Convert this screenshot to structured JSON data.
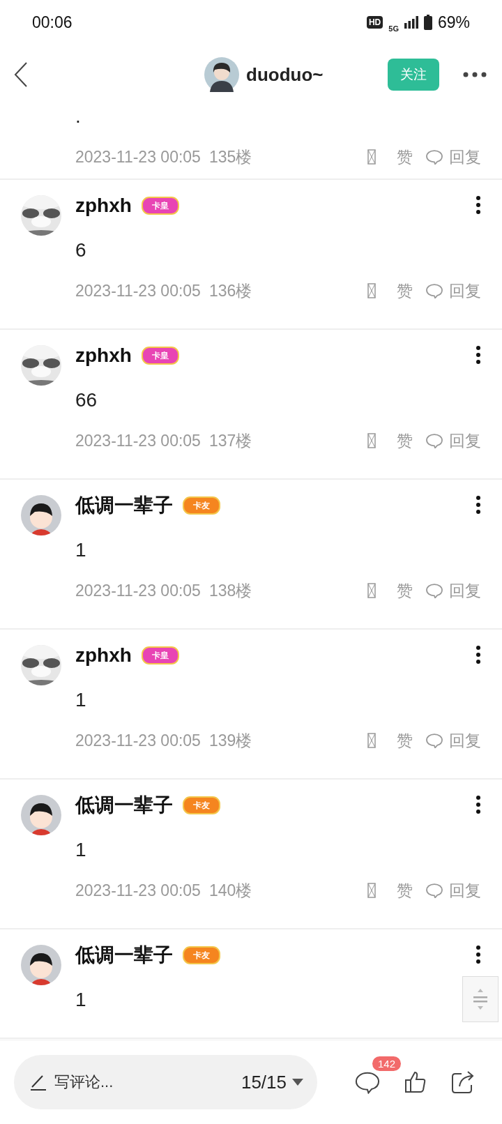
{
  "status_bar": {
    "time": "00:06",
    "hd": "HD",
    "network": "5G",
    "battery": "69%"
  },
  "header": {
    "user": "duoduo~",
    "follow": "关注"
  },
  "posts": [
    {
      "content": ".",
      "date": "2023-11-23 00:05",
      "floor": "135楼",
      "like": "赞",
      "reply": "回复"
    },
    {
      "author": "zphxh",
      "badge": {
        "label": "卡皇",
        "color": "#e844b4"
      },
      "content": "6",
      "date": "2023-11-23 00:05",
      "floor": "136楼",
      "like": "赞",
      "reply": "回复"
    },
    {
      "author": "zphxh",
      "badge": {
        "label": "卡皇",
        "color": "#e844b4"
      },
      "content": "66",
      "date": "2023-11-23 00:05",
      "floor": "137楼",
      "like": "赞",
      "reply": "回复"
    },
    {
      "author": "低调一辈子",
      "avatar": {
        "kind": "cartoon"
      },
      "badge": {
        "label": "卡友",
        "color": "#f5851f"
      },
      "content": "1",
      "date": "2023-11-23 00:05",
      "floor": "138楼",
      "like": "赞",
      "reply": "回复"
    },
    {
      "author": "zphxh",
      "badge": {
        "label": "卡皇",
        "color": "#e844b4"
      },
      "content": "1",
      "date": "2023-11-23 00:05",
      "floor": "139楼",
      "like": "赞",
      "reply": "回复"
    },
    {
      "author": "低调一辈子",
      "avatar": {
        "kind": "cartoon"
      },
      "badge": {
        "label": "卡友",
        "color": "#f5851f"
      },
      "content": "1",
      "date": "2023-11-23 00:05",
      "floor": "140楼",
      "like": "赞",
      "reply": "回复"
    },
    {
      "author": "低调一辈子",
      "avatar": {
        "kind": "cartoon"
      },
      "badge": {
        "label": "卡友",
        "color": "#f5851f"
      },
      "content": "1"
    }
  ],
  "bottom_bar": {
    "placeholder": "写评论...",
    "page": "15/15",
    "comment_count": "142"
  }
}
